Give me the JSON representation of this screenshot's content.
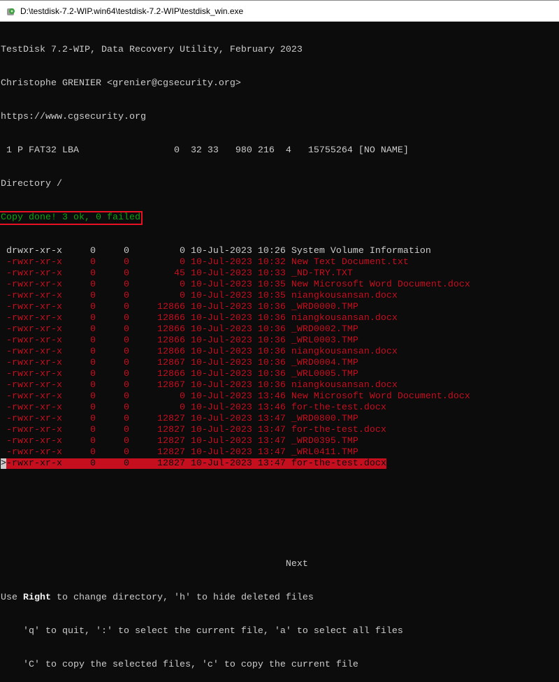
{
  "window": {
    "title": "D:\\testdisk-7.2-WIP.win64\\testdisk-7.2-WIP\\testdisk_win.exe",
    "icon": "testdisk-app-icon"
  },
  "header": {
    "line1": "TestDisk 7.2-WIP, Data Recovery Utility, February 2023",
    "line2": "Christophe GRENIER <grenier@cgsecurity.org>",
    "line3": "https://www.cgsecurity.org",
    "partition": " 1 P FAT32 LBA                 0  32 33   980 216  4   15755264 [NO NAME]",
    "directory": "Directory /",
    "status": "Copy done! 3 ok, 0 failed"
  },
  "colors": {
    "background": "#0c0c0c",
    "text": "#cccccc",
    "deleted": "#c50f1f",
    "status": "#13a10e"
  },
  "files": [
    {
      "perms": "drwxr-xr-x",
      "uid": "0",
      "gid": "0",
      "size": "0",
      "date": "10-Jul-2023",
      "time": "10:26",
      "name": "System Volume Information",
      "deleted": false
    },
    {
      "perms": "-rwxr-xr-x",
      "uid": "0",
      "gid": "0",
      "size": "0",
      "date": "10-Jul-2023",
      "time": "10:32",
      "name": "New Text Document.txt",
      "deleted": true
    },
    {
      "perms": "-rwxr-xr-x",
      "uid": "0",
      "gid": "0",
      "size": "45",
      "date": "10-Jul-2023",
      "time": "10:33",
      "name": "_ND-TRY.TXT",
      "deleted": true
    },
    {
      "perms": "-rwxr-xr-x",
      "uid": "0",
      "gid": "0",
      "size": "0",
      "date": "10-Jul-2023",
      "time": "10:35",
      "name": "New Microsoft Word Document.docx",
      "deleted": true
    },
    {
      "perms": "-rwxr-xr-x",
      "uid": "0",
      "gid": "0",
      "size": "0",
      "date": "10-Jul-2023",
      "time": "10:35",
      "name": "niangkousansan.docx",
      "deleted": true
    },
    {
      "perms": "-rwxr-xr-x",
      "uid": "0",
      "gid": "0",
      "size": "12866",
      "date": "10-Jul-2023",
      "time": "10:36",
      "name": "_WRD0000.TMP",
      "deleted": true
    },
    {
      "perms": "-rwxr-xr-x",
      "uid": "0",
      "gid": "0",
      "size": "12866",
      "date": "10-Jul-2023",
      "time": "10:36",
      "name": "niangkousansan.docx",
      "deleted": true
    },
    {
      "perms": "-rwxr-xr-x",
      "uid": "0",
      "gid": "0",
      "size": "12866",
      "date": "10-Jul-2023",
      "time": "10:36",
      "name": "_WRD0002.TMP",
      "deleted": true
    },
    {
      "perms": "-rwxr-xr-x",
      "uid": "0",
      "gid": "0",
      "size": "12866",
      "date": "10-Jul-2023",
      "time": "10:36",
      "name": "_WRL0003.TMP",
      "deleted": true
    },
    {
      "perms": "-rwxr-xr-x",
      "uid": "0",
      "gid": "0",
      "size": "12866",
      "date": "10-Jul-2023",
      "time": "10:36",
      "name": "niangkousansan.docx",
      "deleted": true
    },
    {
      "perms": "-rwxr-xr-x",
      "uid": "0",
      "gid": "0",
      "size": "12867",
      "date": "10-Jul-2023",
      "time": "10:36",
      "name": "_WRD0004.TMP",
      "deleted": true
    },
    {
      "perms": "-rwxr-xr-x",
      "uid": "0",
      "gid": "0",
      "size": "12866",
      "date": "10-Jul-2023",
      "time": "10:36",
      "name": "_WRL0005.TMP",
      "deleted": true
    },
    {
      "perms": "-rwxr-xr-x",
      "uid": "0",
      "gid": "0",
      "size": "12867",
      "date": "10-Jul-2023",
      "time": "10:36",
      "name": "niangkousansan.docx",
      "deleted": true
    },
    {
      "perms": "-rwxr-xr-x",
      "uid": "0",
      "gid": "0",
      "size": "0",
      "date": "10-Jul-2023",
      "time": "13:46",
      "name": "New Microsoft Word Document.docx",
      "deleted": true
    },
    {
      "perms": "-rwxr-xr-x",
      "uid": "0",
      "gid": "0",
      "size": "0",
      "date": "10-Jul-2023",
      "time": "13:46",
      "name": "for-the-test.docx",
      "deleted": true
    },
    {
      "perms": "-rwxr-xr-x",
      "uid": "0",
      "gid": "0",
      "size": "12827",
      "date": "10-Jul-2023",
      "time": "13:47",
      "name": "_WRD0800.TMP",
      "deleted": true
    },
    {
      "perms": "-rwxr-xr-x",
      "uid": "0",
      "gid": "0",
      "size": "12827",
      "date": "10-Jul-2023",
      "time": "13:47",
      "name": "for-the-test.docx",
      "deleted": true
    },
    {
      "perms": "-rwxr-xr-x",
      "uid": "0",
      "gid": "0",
      "size": "12827",
      "date": "10-Jul-2023",
      "time": "13:47",
      "name": "_WRD0395.TMP",
      "deleted": true
    },
    {
      "perms": "-rwxr-xr-x",
      "uid": "0",
      "gid": "0",
      "size": "12827",
      "date": "10-Jul-2023",
      "time": "13:47",
      "name": "_WRL0411.TMP",
      "deleted": true
    },
    {
      "perms": "-rwxr-xr-x",
      "uid": "0",
      "gid": "0",
      "size": "12827",
      "date": "10-Jul-2023",
      "time": "13:47",
      "name": "for-the-test.docx",
      "deleted": true,
      "selected": true
    }
  ],
  "cursor": ">",
  "footer": {
    "next": "Next",
    "help1_pre": "Use ",
    "help1_key": "Right",
    "help1_post": " to change directory, 'h' to hide deleted files",
    "help2": "    'q' to quit, ':' to select the current file, 'a' to select all files",
    "help3": "    'C' to copy the selected files, 'c' to copy the current file"
  }
}
